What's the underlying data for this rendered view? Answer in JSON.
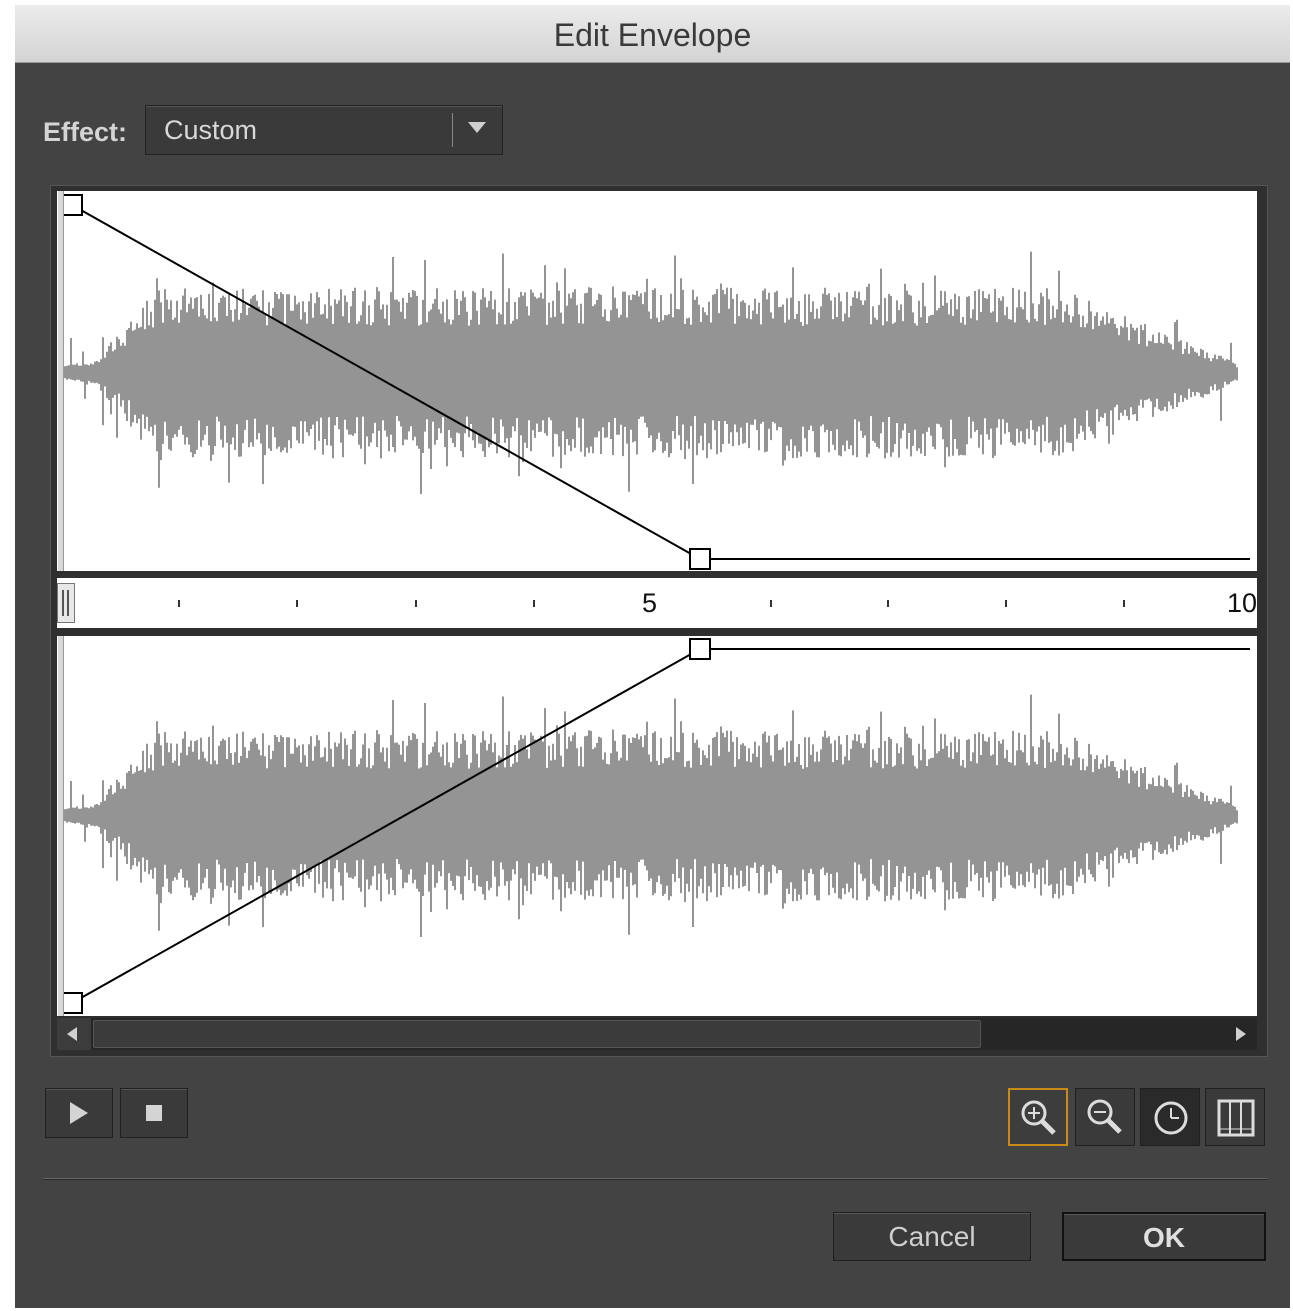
{
  "window": {
    "title": "Edit Envelope"
  },
  "effect": {
    "label": "Effect:",
    "value": "Custom"
  },
  "ruler": {
    "labels": [
      "5",
      "10"
    ]
  },
  "controls": {
    "play": "play-icon",
    "stop": "stop-icon",
    "zoom_in": "zoom-in-icon",
    "zoom_out": "zoom-out-icon",
    "seconds": "clock-icon",
    "frames": "frames-icon"
  },
  "buttons": {
    "cancel": "Cancel",
    "ok": "OK"
  },
  "colors": {
    "dialog_bg": "#434343",
    "waveform": "#7a7a7a",
    "zoom_highlight": "#c98a18"
  }
}
